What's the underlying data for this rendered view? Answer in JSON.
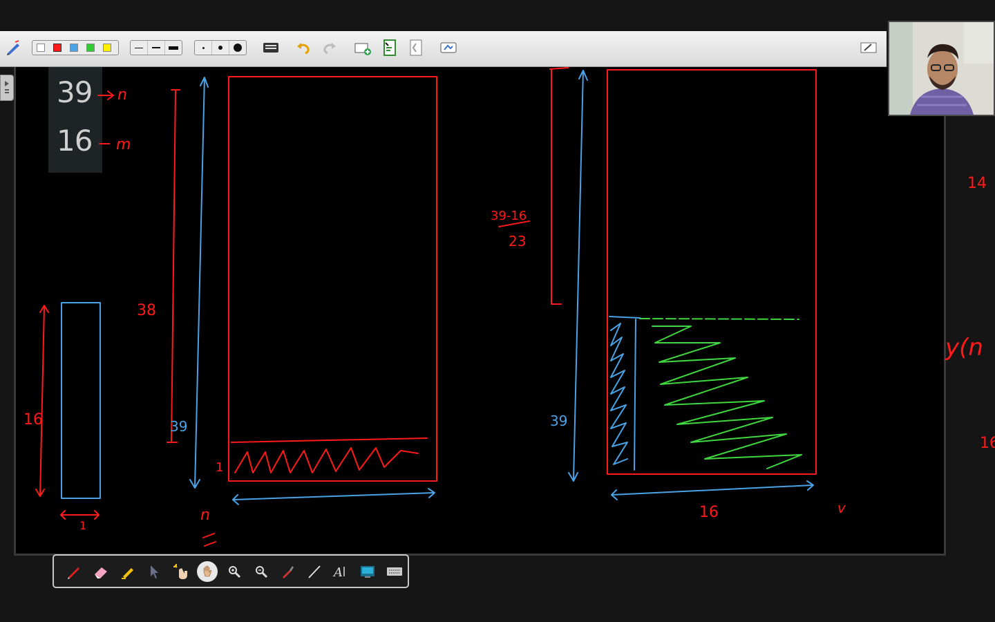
{
  "toolbar": {
    "colors": [
      "#ffffff",
      "#ff1a1a",
      "#4aa3e6",
      "#33cc33",
      "#ffee00"
    ],
    "line_widths": [
      "thin",
      "medium",
      "thick"
    ],
    "dot_sizes": [
      "small",
      "medium",
      "large"
    ],
    "tools": [
      "keyboard-icon",
      "undo-icon",
      "redo-icon",
      "add-page-icon",
      "page-green-icon",
      "page-blank-icon",
      "screen-capture-icon",
      "edit-mode-icon"
    ]
  },
  "counter": {
    "first": "39",
    "second": "16"
  },
  "annotations": {
    "n_label": "n",
    "m_label": "m",
    "left_38": "38",
    "left_39": "39",
    "left_16": "16",
    "left_1_width": "1",
    "left_1_small": "1",
    "n_bottom": "n",
    "right_39_16": "39-16",
    "right_23": "23",
    "right_39": "39",
    "right_16": "16",
    "right_edge_14": "14",
    "right_edge_16": "16",
    "right_edge_yn": "y(n",
    "right_v": "v"
  },
  "bottom_tools": [
    "pen-icon",
    "eraser-icon",
    "highlighter-icon",
    "pointer-icon",
    "magic-hand-icon",
    "hand-icon",
    "zoom-in-icon",
    "zoom-out-icon",
    "dropper-icon",
    "line-icon",
    "text-icon",
    "screen-icon",
    "keyboard-icon"
  ],
  "colors": {
    "red_ink": "#ff1a1a",
    "blue_ink": "#4aa3e6",
    "green_ink": "#3fd83f"
  }
}
